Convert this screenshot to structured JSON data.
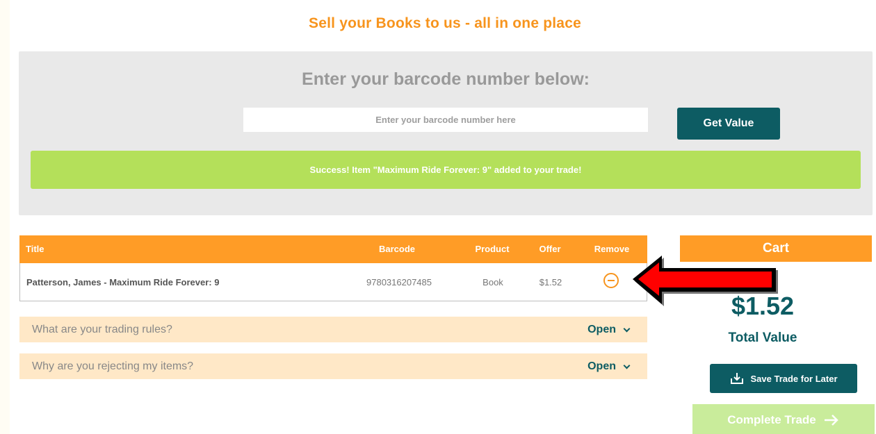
{
  "headline": "Sell your Books to us - all in one place",
  "scan": {
    "title": "Enter your barcode number below:",
    "placeholder": "Enter your barcode number here",
    "value": "",
    "get_value_label": "Get Value"
  },
  "success_message": "Success! Item \"Maximum Ride Forever: 9\" added to your trade!",
  "table": {
    "headers": {
      "title": "Title",
      "barcode": "Barcode",
      "product": "Product",
      "offer": "Offer",
      "remove": "Remove"
    },
    "rows": [
      {
        "title": "Patterson, James - Maximum Ride Forever: 9",
        "barcode": "9780316207485",
        "product": "Book",
        "offer": "$1.52"
      }
    ]
  },
  "faqs": [
    {
      "question": "What are your trading rules?",
      "toggle": "Open"
    },
    {
      "question": "Why are you rejecting my items?",
      "toggle": "Open"
    }
  ],
  "cart": {
    "header": "Cart",
    "total_amount": "$1.52",
    "total_label": "Total Value",
    "save_label": "Save Trade for Later",
    "complete_label": "Complete Trade"
  },
  "colors": {
    "accent_orange": "#ff9c26",
    "teal": "#0d5c63",
    "success_green": "#b4e05a",
    "annotation_red": "#ff0000"
  },
  "icons": [
    "remove-circle-icon",
    "chevron-down-icon",
    "download-icon",
    "arrow-right-icon",
    "red-pointer-arrow"
  ]
}
